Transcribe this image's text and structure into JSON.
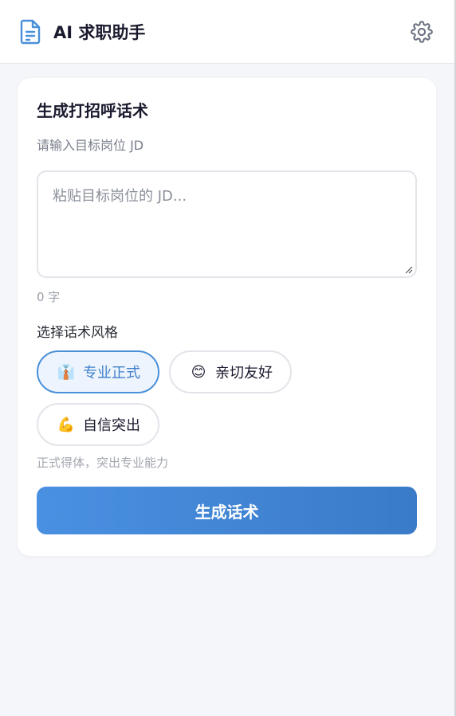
{
  "header": {
    "title": "AI 求职助手",
    "brand_icon": "document-icon",
    "settings_icon": "gear-icon"
  },
  "card": {
    "title": "生成打招呼话术",
    "jd_label": "请输入目标岗位 JD",
    "jd_value": "",
    "jd_placeholder": "粘贴目标岗位的 JD...",
    "char_count": "0 字",
    "style_label": "选择话术风格",
    "styles": [
      {
        "emoji": "👔",
        "icon": "necktie-icon",
        "label": "专业正式",
        "selected": true
      },
      {
        "emoji": "😊",
        "icon": "smiling-face-icon",
        "label": "亲切友好",
        "selected": false
      },
      {
        "emoji": "💪",
        "icon": "flexed-biceps-icon",
        "label": "自信突出",
        "selected": false
      }
    ],
    "style_description": "正式得体，突出专业能力",
    "generate_label": "生成话术"
  },
  "colors": {
    "accent": "#4a90d9",
    "button_start": "#4a90e2",
    "button_end": "#3a7bc8",
    "background": "#f5f6fa"
  }
}
